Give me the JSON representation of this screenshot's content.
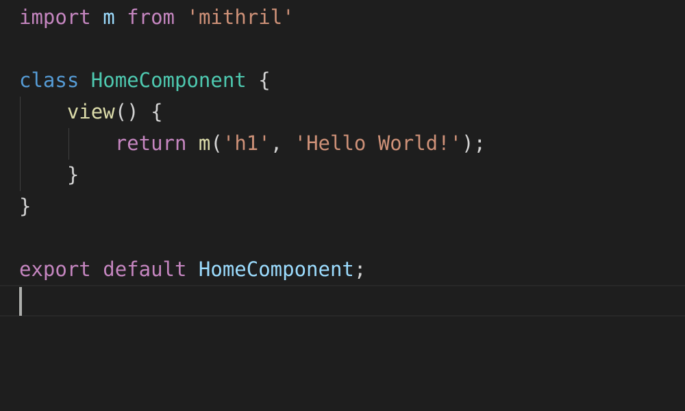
{
  "editor": {
    "theme": {
      "background": "#1e1e1e",
      "keyword_control": "#c586c0",
      "keyword_storage": "#569cd6",
      "variable": "#9cdcfe",
      "class_name": "#4ec9b0",
      "function": "#dcdcaa",
      "string": "#ce9178",
      "punctuation": "#d4d4d4"
    },
    "lines": [
      [
        {
          "text": "import",
          "kind": "keyword_control"
        },
        {
          "text": " ",
          "kind": "punctuation"
        },
        {
          "text": "m",
          "kind": "variable"
        },
        {
          "text": " ",
          "kind": "punctuation"
        },
        {
          "text": "from",
          "kind": "keyword_control"
        },
        {
          "text": " ",
          "kind": "punctuation"
        },
        {
          "text": "'mithril'",
          "kind": "string"
        }
      ],
      [],
      [
        {
          "text": "class",
          "kind": "keyword_storage"
        },
        {
          "text": " ",
          "kind": "punctuation"
        },
        {
          "text": "HomeComponent",
          "kind": "class_name"
        },
        {
          "text": " {",
          "kind": "punctuation"
        }
      ],
      [
        {
          "text": "    ",
          "kind": "punctuation"
        },
        {
          "text": "view",
          "kind": "function"
        },
        {
          "text": "() {",
          "kind": "punctuation"
        }
      ],
      [
        {
          "text": "        ",
          "kind": "punctuation"
        },
        {
          "text": "return",
          "kind": "keyword_control"
        },
        {
          "text": " ",
          "kind": "punctuation"
        },
        {
          "text": "m",
          "kind": "function"
        },
        {
          "text": "(",
          "kind": "punctuation"
        },
        {
          "text": "'h1'",
          "kind": "string"
        },
        {
          "text": ", ",
          "kind": "punctuation"
        },
        {
          "text": "'Hello World!'",
          "kind": "string"
        },
        {
          "text": ");",
          "kind": "punctuation"
        }
      ],
      [
        {
          "text": "    }",
          "kind": "punctuation"
        }
      ],
      [
        {
          "text": "}",
          "kind": "punctuation"
        }
      ],
      [],
      [
        {
          "text": "export",
          "kind": "keyword_control"
        },
        {
          "text": " ",
          "kind": "punctuation"
        },
        {
          "text": "default",
          "kind": "keyword_control"
        },
        {
          "text": " ",
          "kind": "punctuation"
        },
        {
          "text": "HomeComponent",
          "kind": "variable"
        },
        {
          "text": ";",
          "kind": "punctuation"
        }
      ],
      []
    ]
  }
}
